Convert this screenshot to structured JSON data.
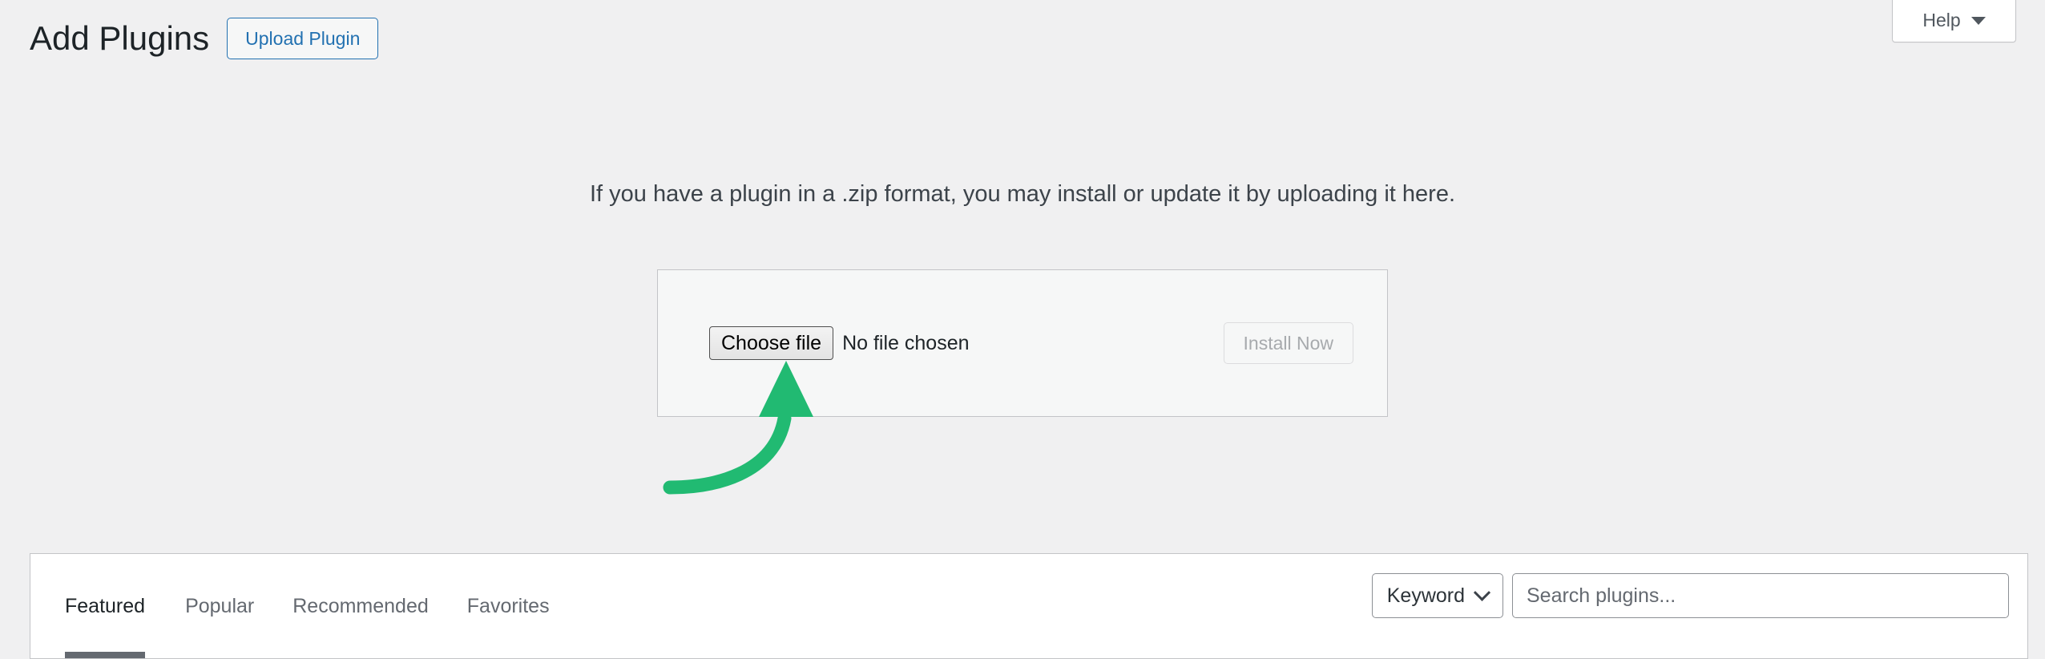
{
  "screen_reader_label": "Add Plugins",
  "help_tab": {
    "label": "Help",
    "caret_icon": "triangle-down-icon"
  },
  "header": {
    "title": "Add Plugins",
    "upload_plugin_label": "Upload Plugin"
  },
  "upload": {
    "intro_text": "If you have a plugin in a .zip format, you may install or update it by uploading it here.",
    "choose_file_label": "Choose file",
    "no_file_text": "No file chosen",
    "install_now_label": "Install Now"
  },
  "annotation": {
    "shape": "curved-arrow-up",
    "color": "#21ba72",
    "points_to": "choose-file-button"
  },
  "plugin_browser": {
    "tabs": [
      {
        "label": "Featured",
        "active": true
      },
      {
        "label": "Popular",
        "active": false
      },
      {
        "label": "Recommended",
        "active": false
      },
      {
        "label": "Favorites",
        "active": false
      }
    ],
    "search_type": {
      "selected": "Keyword",
      "chevron_icon": "chevron-down-icon"
    },
    "search": {
      "value": "",
      "placeholder": "Search plugins..."
    }
  },
  "colors": {
    "page_background": "#f0f0f1",
    "card_background": "#ffffff",
    "border": "#c3c4c7",
    "link_blue": "#2271b1",
    "text_dark": "#1d2327",
    "text_muted": "#646970",
    "annotation_green": "#21ba72",
    "active_tab_underline": "#646970"
  }
}
